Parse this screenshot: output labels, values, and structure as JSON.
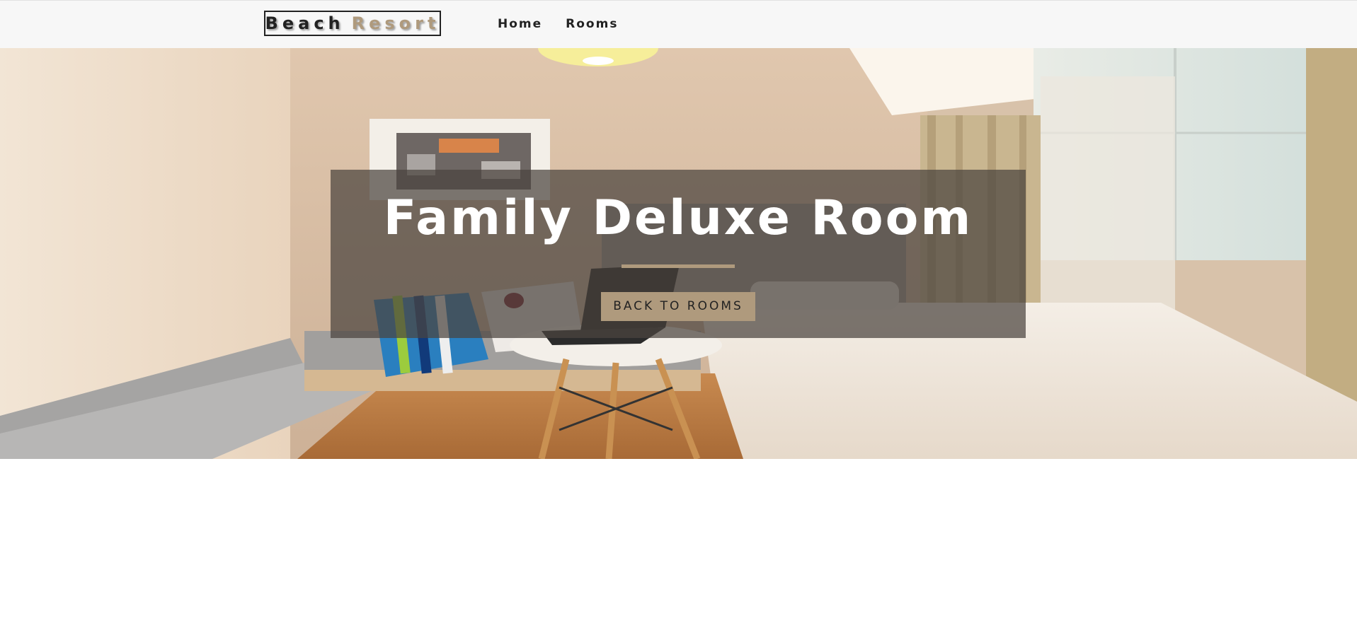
{
  "navbar": {
    "logo_primary": "Beach",
    "logo_secondary": "Resort",
    "links": [
      {
        "label": "Home"
      },
      {
        "label": "Rooms"
      }
    ]
  },
  "hero": {
    "title": "Family Deluxe Room",
    "button_label": "BACK TO ROOMS",
    "image_description_icon": "hotel-room-photo"
  },
  "colors": {
    "accent": "#af9a7d",
    "dark": "#222222",
    "nav_bg": "#f7f7f7",
    "banner_overlay": "rgba(75,68,62,0.72)"
  }
}
